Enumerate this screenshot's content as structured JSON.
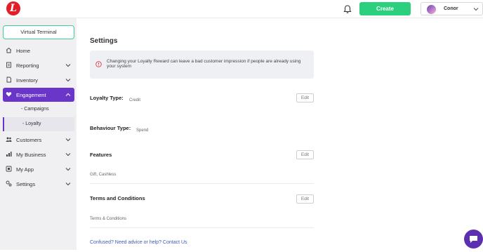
{
  "topbar": {
    "logo_icon": "brand-logo-icon",
    "bell_icon": "bell-icon",
    "create_label": "Create",
    "user_name": "Conor",
    "accent_color": "#2bd07f"
  },
  "sidebar": {
    "virtual_terminal_label": "Virtual Terminal",
    "items": [
      {
        "label": "Home",
        "icon": "home-icon",
        "has_chevron": false
      },
      {
        "label": "Reporting",
        "icon": "file-icon",
        "has_chevron": true
      },
      {
        "label": "Inventory",
        "icon": "document-icon",
        "has_chevron": true
      },
      {
        "label": "Engagement",
        "icon": "heart-icon",
        "has_chevron": true,
        "active": true
      },
      {
        "label": "- Campaigns"
      },
      {
        "label": "- Loyalty",
        "active": true
      },
      {
        "label": "Customers",
        "icon": "users-icon",
        "has_chevron": true
      },
      {
        "label": "My Business",
        "icon": "chart-icon",
        "has_chevron": true
      },
      {
        "label": "My App",
        "icon": "app-icon",
        "has_chevron": true
      },
      {
        "label": "Settings",
        "icon": "settings-icon",
        "has_chevron": true
      }
    ],
    "active_color": "#6a35c9"
  },
  "main": {
    "title": "Settings",
    "alert_text": "Changing your Loyalty Reward can leave a bad customer impression if people are already using your system",
    "sections": {
      "loyalty_type": {
        "label": "Loyalty Type:",
        "value": "Credit",
        "edit_label": "Edit"
      },
      "behaviour_type": {
        "label": "Behaviour Type:",
        "value": "Spend"
      },
      "features": {
        "label": "Features",
        "value": "Gift, Cashless",
        "edit_label": "Edit"
      },
      "terms": {
        "label": "Terms and Conditions",
        "value": "Terms & Conditions",
        "edit_label": "Edit"
      }
    },
    "help_link": "Confused? Need advice or help? Contact Us"
  }
}
